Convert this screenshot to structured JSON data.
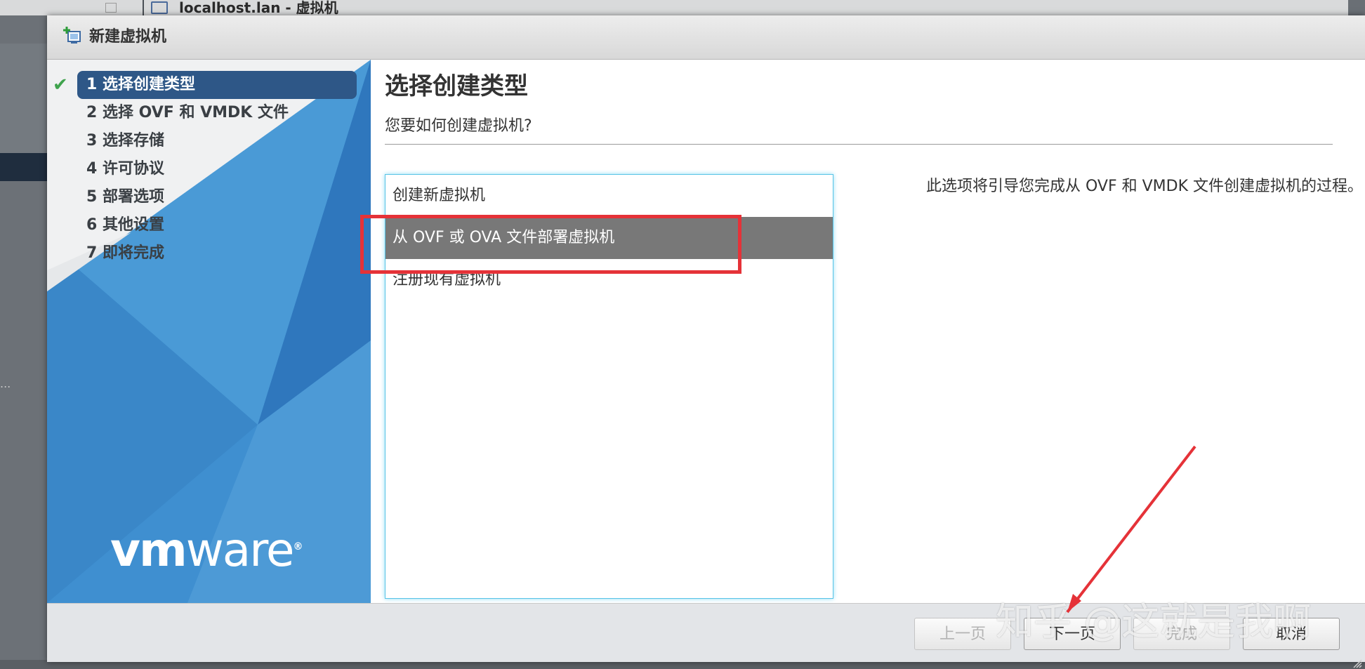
{
  "background": {
    "window_title": "localhost.lan - 虚拟机",
    "left_overflow": "..."
  },
  "dialog": {
    "title": "新建虚拟机",
    "steps": [
      {
        "label": "1 选择创建类型",
        "active": true,
        "done": true
      },
      {
        "label": "2 选择 OVF 和 VMDK 文件"
      },
      {
        "label": "3 选择存储"
      },
      {
        "label": "4 许可协议"
      },
      {
        "label": "5 部署选项"
      },
      {
        "label": "6 其他设置"
      },
      {
        "label": "7 即将完成"
      }
    ],
    "brand": {
      "bold": "vm",
      "light": "ware",
      "mark": "®"
    }
  },
  "main": {
    "title": "选择创建类型",
    "subtitle": "您要如何创建虚拟机?",
    "options": [
      {
        "label": "创建新虚拟机"
      },
      {
        "label": "从 OVF 或 OVA 文件部署虚拟机",
        "selected": true
      },
      {
        "label": "注册现有虚拟机"
      }
    ],
    "description": "此选项将引导您完成从 OVF 和 VMDK 文件创建虚拟机的过程。"
  },
  "footer": {
    "prev_label": "上一页",
    "next_label": "下一页",
    "finish_label": "完成",
    "cancel_label": "取消"
  },
  "annotation": {
    "watermark": "知乎 @这就是我啊",
    "highlight_color": "#e53238"
  },
  "colors": {
    "accent": "#2e5787",
    "sidebar_blue": "#3f8fd0",
    "selected_row": "#787878",
    "check_green": "#3fa34d",
    "listbox_border": "#57c3e6"
  }
}
